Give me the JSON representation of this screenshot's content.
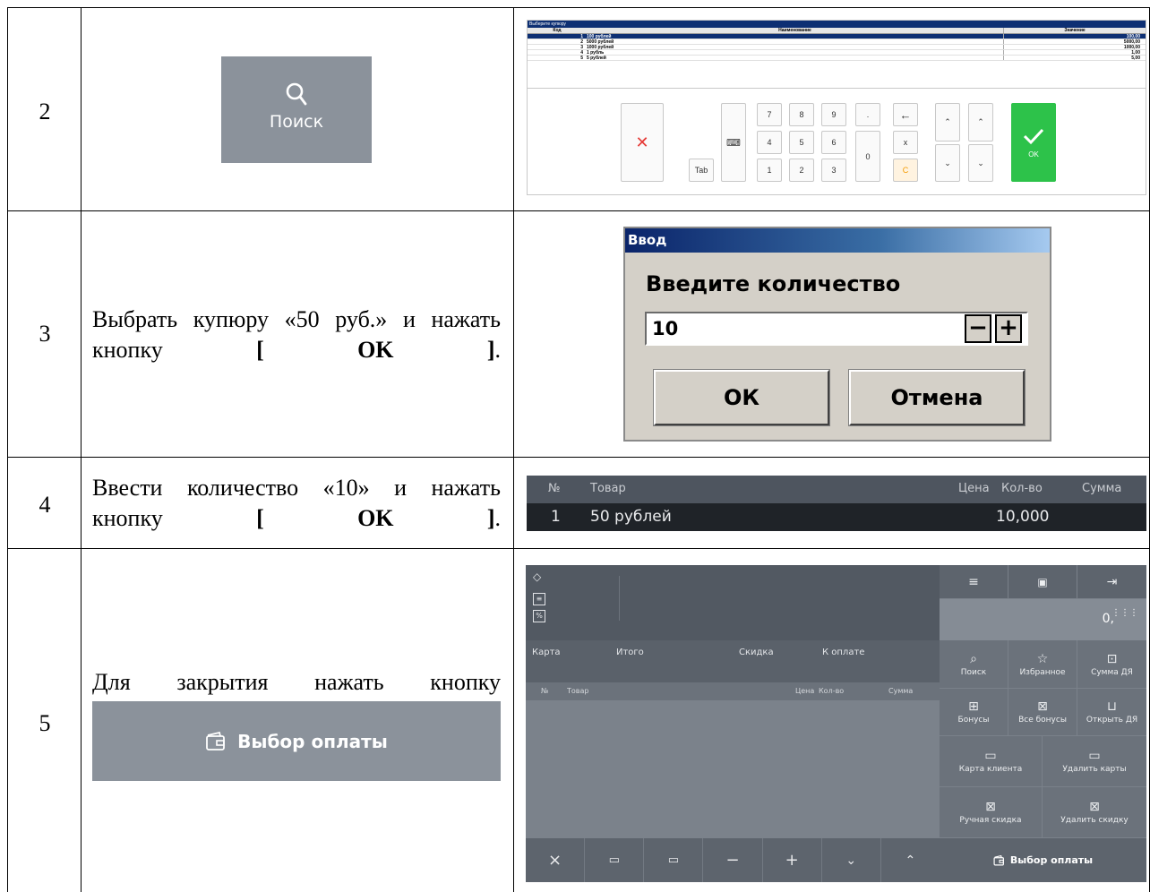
{
  "rows": [
    {
      "num": "2"
    },
    {
      "num": "3",
      "text": "Выбрать купюру «50 руб.» и нажать кнопку",
      "bold": "[ OK ]",
      "tail": "."
    },
    {
      "num": "4",
      "text": "Ввести количество «10» и нажать кнопку",
      "bold": "[ OK ]",
      "tail": "."
    },
    {
      "num": "5",
      "text": "Для закрытия нажать кнопку"
    }
  ],
  "search_tile": {
    "label": "Поиск",
    "icon": "search-icon"
  },
  "mini_dialog": {
    "title": "Выберите купюру",
    "headers": [
      "Код",
      "Наименование",
      "Значение"
    ],
    "items": [
      {
        "code": "1",
        "name": "100 рублей",
        "value": "100,00"
      },
      {
        "code": "2",
        "name": "5000 рублей",
        "value": "5000,00"
      },
      {
        "code": "3",
        "name": "1000 рублей",
        "value": "1000,00"
      },
      {
        "code": "4",
        "name": "1 рубль",
        "value": "1,00"
      },
      {
        "code": "5",
        "name": "5 рублей",
        "value": "5,00"
      }
    ],
    "keys": {
      "tab": "Tab",
      "k7": "7",
      "k8": "8",
      "k9": "9",
      "dot": ".",
      "k4": "4",
      "k5": "5",
      "k6": "6",
      "k0": "0",
      "x": "x",
      "k1": "1",
      "k2": "2",
      "k3": "3",
      "c": "C",
      "ok": "OK"
    }
  },
  "input_dialog": {
    "title": "Ввод",
    "prompt": "Введите количество",
    "value": "10",
    "minus": "−",
    "plus": "+",
    "ok": "ОК",
    "cancel": "Отмена"
  },
  "grid_strip": {
    "headers": {
      "num": "№",
      "product": "Товар",
      "price": "Цена",
      "qty": "Кол-во",
      "sum": "Сумма"
    },
    "row": {
      "num": "1",
      "product": "50 рублей",
      "qty": "10,000"
    }
  },
  "pay_button": {
    "label": "Выбор оплаты",
    "icon": "wallet-icon"
  },
  "pos": {
    "summary": {
      "card": "Карта",
      "total": "Итого",
      "discount": "Скидка",
      "to_pay": "К оплате"
    },
    "grid_headers": {
      "num": "№",
      "product": "Товар",
      "price": "Цена",
      "qty": "Кол-во",
      "sum": "Сумма"
    },
    "display_value": "0,",
    "tiles": {
      "search": "Поиск",
      "favorites": "Избранное",
      "sum_dya": "Сумма ДЯ",
      "bonuses": "Бонусы",
      "all_bonuses": "Все бонусы",
      "open_dya": "Открыть ДЯ",
      "client_card": "Карта клиента",
      "remove_cards": "Удалить карты",
      "manual_discount": "Ручная скидка",
      "remove_discount": "Удалить скидку"
    },
    "pay_label": "Выбор оплаты",
    "colors": {
      "panel": "#5d646d",
      "tile": "#6b727b",
      "grid": "#7b828b"
    }
  }
}
